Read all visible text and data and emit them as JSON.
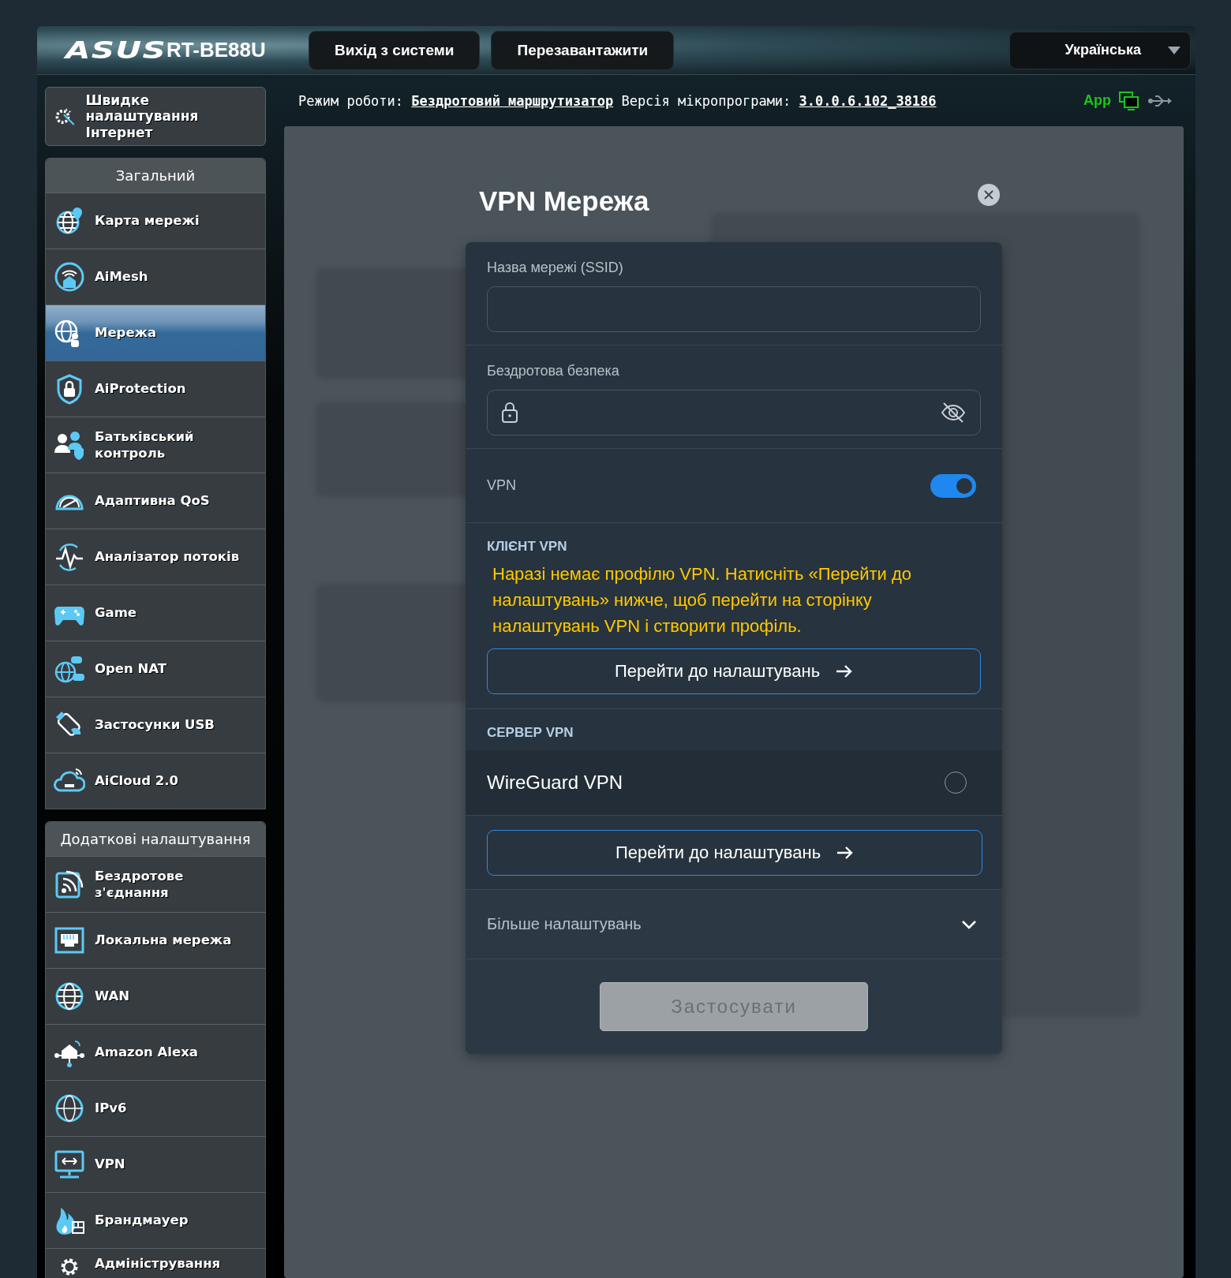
{
  "header": {
    "logo": "ASUS",
    "model": "RT-BE88U",
    "buttons": [
      "Вихід з системи",
      "Перезавантажити"
    ],
    "language": "Українська"
  },
  "info_bar": {
    "mode_label": "Режим роботи:",
    "mode": "Бездротовий маршрутизатор",
    "firmware_label": "Версія мікропрограми:",
    "firmware": "3.0.0.6.102_38186",
    "app": "App"
  },
  "sidebar": {
    "quick_setup": "Швидке налаштування Інтернет",
    "sections": [
      {
        "title": "Загальний",
        "items": [
          {
            "label": "Карта мережі",
            "selected": false
          },
          {
            "label": "AiMesh",
            "selected": false
          },
          {
            "label": "Мережа",
            "selected": true
          },
          {
            "label": "AiProtection",
            "selected": false
          },
          {
            "label": "Батьківський контроль",
            "selected": false
          },
          {
            "label": "Адаптивна QoS",
            "selected": false
          },
          {
            "label": "Аналізатор потоків",
            "selected": false
          },
          {
            "label": "Game",
            "selected": false
          },
          {
            "label": "Open NAT",
            "selected": false
          },
          {
            "label": "Застосунки USB",
            "selected": false
          },
          {
            "label": "AiCloud 2.0",
            "selected": false
          }
        ]
      },
      {
        "title": "Додаткові налаштування",
        "items": [
          {
            "label": "Бездротове з'єднання",
            "selected": false
          },
          {
            "label": "Локальна мережа",
            "selected": false
          },
          {
            "label": "WAN",
            "selected": false
          },
          {
            "label": "Amazon Alexa",
            "selected": false
          },
          {
            "label": "IPv6",
            "selected": false
          },
          {
            "label": "VPN",
            "selected": false
          },
          {
            "label": "Брандмауер",
            "selected": false
          },
          {
            "label": "Адміністрування",
            "selected": false
          }
        ]
      }
    ]
  },
  "modal": {
    "title": "VPN Мережа",
    "ssid": {
      "label": "Назва мережі (SSID)"
    },
    "security": {
      "label": "Бездротова безпека"
    },
    "vpn_toggle": {
      "label": "VPN",
      "on": true
    },
    "client": {
      "heading": "КЛІЄНТ VPN",
      "message": "Наразі немає профілю VPN. Натисніть «Перейти до налаштувань» нижче, щоб перейти на сторінку налаштувань VPN і створити профіль.",
      "button": "Перейти до налаштувань"
    },
    "server": {
      "heading": "СЕРВЕР VPN",
      "options": [
        {
          "label": "WireGuard VPN",
          "selected": false
        }
      ],
      "button": "Перейти до налаштувань"
    },
    "more": {
      "label": "Більше налаштувань",
      "expanded": false
    },
    "apply": {
      "label": "Застосувати",
      "disabled": true
    }
  }
}
